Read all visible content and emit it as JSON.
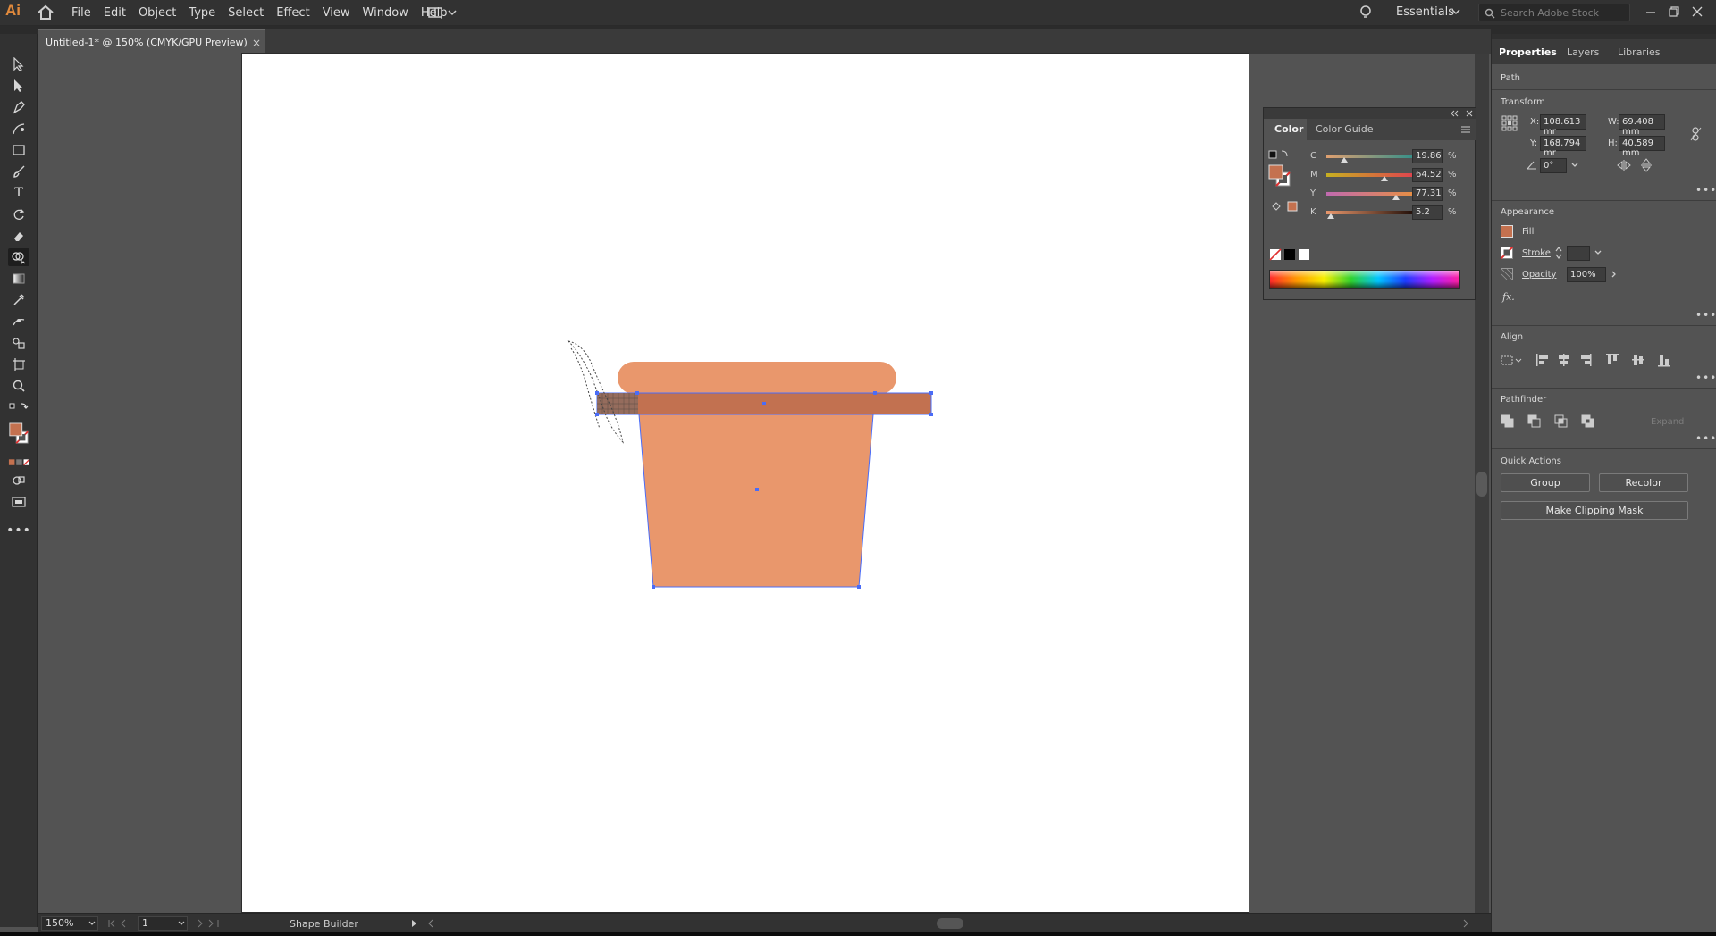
{
  "app": {
    "logo": "Ai",
    "workspace": "Essentials"
  },
  "menu": [
    "File",
    "Edit",
    "Object",
    "Type",
    "Select",
    "Effect",
    "View",
    "Window",
    "Help"
  ],
  "search": {
    "placeholder": "Search Adobe Stock"
  },
  "document_tab": {
    "title": "Untitled-1* @ 150% (CMYK/GPU Preview)",
    "close": "×"
  },
  "status": {
    "zoom": "150%",
    "artboard": "1",
    "tool": "Shape Builder"
  },
  "colors": {
    "fill": "#c4714f",
    "pot_light": "#e9976c",
    "rim": "#c27150",
    "selection": "#4a6cf7"
  },
  "color_panel": {
    "tabs": [
      "Color",
      "Color Guide"
    ],
    "sliders": [
      {
        "label": "C",
        "value": "19.86",
        "level": 0.1986
      },
      {
        "label": "M",
        "value": "64.52",
        "level": 0.6452
      },
      {
        "label": "Y",
        "value": "77.31",
        "level": 0.7731
      },
      {
        "label": "K",
        "value": "5.2",
        "level": 0.052
      }
    ],
    "unit": "%"
  },
  "properties": {
    "tabs": [
      "Properties",
      "Layers",
      "Libraries"
    ],
    "object_type": "Path",
    "transform": {
      "title": "Transform",
      "x": "108.613 mr",
      "y": "168.794 mr",
      "w": "69.408 mm",
      "h": "40.589 mm",
      "angle": "0°",
      "x_label": "X:",
      "y_label": "Y:",
      "w_label": "W:",
      "h_label": "H:"
    },
    "appearance": {
      "title": "Appearance",
      "fill": "Fill",
      "stroke": "Stroke",
      "opacity": "Opacity",
      "opacity_value": "100%",
      "fx": "fx."
    },
    "align": {
      "title": "Align"
    },
    "pathfinder": {
      "title": "Pathfinder",
      "expand": "Expand"
    },
    "quick_actions": {
      "title": "Quick Actions",
      "group": "Group",
      "recolor": "Recolor",
      "clipping": "Make Clipping Mask"
    }
  }
}
